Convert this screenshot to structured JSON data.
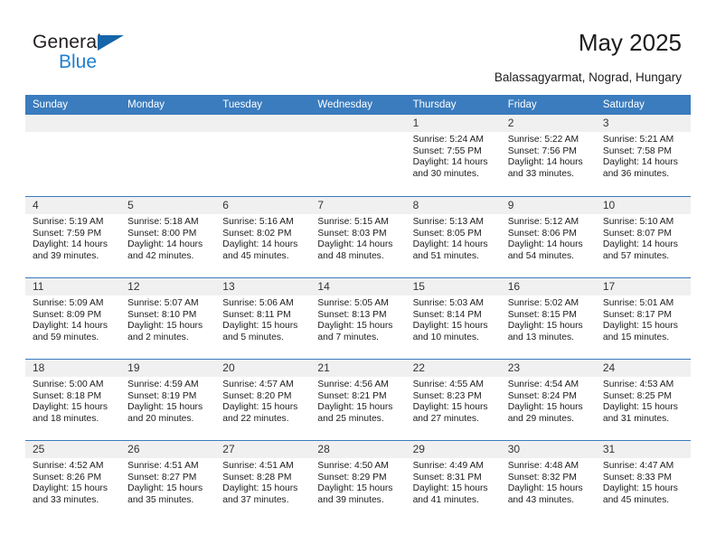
{
  "brand": {
    "name_part1": "General",
    "name_part2": "Blue",
    "triangle_icon": "triangle-icon",
    "color_dark": "#231f20",
    "color_blue": "#1f7fd0"
  },
  "header": {
    "title": "May 2025",
    "subtitle": "Balassagyarmat, Nograd, Hungary"
  },
  "theme": {
    "header_blue": "#3a7cbe",
    "band_gray": "#f0f0f0",
    "text": "#1c1c1c"
  },
  "calendar": {
    "weekday_headers": [
      "Sunday",
      "Monday",
      "Tuesday",
      "Wednesday",
      "Thursday",
      "Friday",
      "Saturday"
    ],
    "weeks": [
      [
        {
          "day": "",
          "empty": true
        },
        {
          "day": "",
          "empty": true
        },
        {
          "day": "",
          "empty": true
        },
        {
          "day": "",
          "empty": true
        },
        {
          "day": "1",
          "sunrise": "Sunrise: 5:24 AM",
          "sunset": "Sunset: 7:55 PM",
          "daylight1": "Daylight: 14 hours",
          "daylight2": "and 30 minutes."
        },
        {
          "day": "2",
          "sunrise": "Sunrise: 5:22 AM",
          "sunset": "Sunset: 7:56 PM",
          "daylight1": "Daylight: 14 hours",
          "daylight2": "and 33 minutes."
        },
        {
          "day": "3",
          "sunrise": "Sunrise: 5:21 AM",
          "sunset": "Sunset: 7:58 PM",
          "daylight1": "Daylight: 14 hours",
          "daylight2": "and 36 minutes."
        }
      ],
      [
        {
          "day": "4",
          "sunrise": "Sunrise: 5:19 AM",
          "sunset": "Sunset: 7:59 PM",
          "daylight1": "Daylight: 14 hours",
          "daylight2": "and 39 minutes."
        },
        {
          "day": "5",
          "sunrise": "Sunrise: 5:18 AM",
          "sunset": "Sunset: 8:00 PM",
          "daylight1": "Daylight: 14 hours",
          "daylight2": "and 42 minutes."
        },
        {
          "day": "6",
          "sunrise": "Sunrise: 5:16 AM",
          "sunset": "Sunset: 8:02 PM",
          "daylight1": "Daylight: 14 hours",
          "daylight2": "and 45 minutes."
        },
        {
          "day": "7",
          "sunrise": "Sunrise: 5:15 AM",
          "sunset": "Sunset: 8:03 PM",
          "daylight1": "Daylight: 14 hours",
          "daylight2": "and 48 minutes."
        },
        {
          "day": "8",
          "sunrise": "Sunrise: 5:13 AM",
          "sunset": "Sunset: 8:05 PM",
          "daylight1": "Daylight: 14 hours",
          "daylight2": "and 51 minutes."
        },
        {
          "day": "9",
          "sunrise": "Sunrise: 5:12 AM",
          "sunset": "Sunset: 8:06 PM",
          "daylight1": "Daylight: 14 hours",
          "daylight2": "and 54 minutes."
        },
        {
          "day": "10",
          "sunrise": "Sunrise: 5:10 AM",
          "sunset": "Sunset: 8:07 PM",
          "daylight1": "Daylight: 14 hours",
          "daylight2": "and 57 minutes."
        }
      ],
      [
        {
          "day": "11",
          "sunrise": "Sunrise: 5:09 AM",
          "sunset": "Sunset: 8:09 PM",
          "daylight1": "Daylight: 14 hours",
          "daylight2": "and 59 minutes."
        },
        {
          "day": "12",
          "sunrise": "Sunrise: 5:07 AM",
          "sunset": "Sunset: 8:10 PM",
          "daylight1": "Daylight: 15 hours",
          "daylight2": "and 2 minutes."
        },
        {
          "day": "13",
          "sunrise": "Sunrise: 5:06 AM",
          "sunset": "Sunset: 8:11 PM",
          "daylight1": "Daylight: 15 hours",
          "daylight2": "and 5 minutes."
        },
        {
          "day": "14",
          "sunrise": "Sunrise: 5:05 AM",
          "sunset": "Sunset: 8:13 PM",
          "daylight1": "Daylight: 15 hours",
          "daylight2": "and 7 minutes."
        },
        {
          "day": "15",
          "sunrise": "Sunrise: 5:03 AM",
          "sunset": "Sunset: 8:14 PM",
          "daylight1": "Daylight: 15 hours",
          "daylight2": "and 10 minutes."
        },
        {
          "day": "16",
          "sunrise": "Sunrise: 5:02 AM",
          "sunset": "Sunset: 8:15 PM",
          "daylight1": "Daylight: 15 hours",
          "daylight2": "and 13 minutes."
        },
        {
          "day": "17",
          "sunrise": "Sunrise: 5:01 AM",
          "sunset": "Sunset: 8:17 PM",
          "daylight1": "Daylight: 15 hours",
          "daylight2": "and 15 minutes."
        }
      ],
      [
        {
          "day": "18",
          "sunrise": "Sunrise: 5:00 AM",
          "sunset": "Sunset: 8:18 PM",
          "daylight1": "Daylight: 15 hours",
          "daylight2": "and 18 minutes."
        },
        {
          "day": "19",
          "sunrise": "Sunrise: 4:59 AM",
          "sunset": "Sunset: 8:19 PM",
          "daylight1": "Daylight: 15 hours",
          "daylight2": "and 20 minutes."
        },
        {
          "day": "20",
          "sunrise": "Sunrise: 4:57 AM",
          "sunset": "Sunset: 8:20 PM",
          "daylight1": "Daylight: 15 hours",
          "daylight2": "and 22 minutes."
        },
        {
          "day": "21",
          "sunrise": "Sunrise: 4:56 AM",
          "sunset": "Sunset: 8:21 PM",
          "daylight1": "Daylight: 15 hours",
          "daylight2": "and 25 minutes."
        },
        {
          "day": "22",
          "sunrise": "Sunrise: 4:55 AM",
          "sunset": "Sunset: 8:23 PM",
          "daylight1": "Daylight: 15 hours",
          "daylight2": "and 27 minutes."
        },
        {
          "day": "23",
          "sunrise": "Sunrise: 4:54 AM",
          "sunset": "Sunset: 8:24 PM",
          "daylight1": "Daylight: 15 hours",
          "daylight2": "and 29 minutes."
        },
        {
          "day": "24",
          "sunrise": "Sunrise: 4:53 AM",
          "sunset": "Sunset: 8:25 PM",
          "daylight1": "Daylight: 15 hours",
          "daylight2": "and 31 minutes."
        }
      ],
      [
        {
          "day": "25",
          "sunrise": "Sunrise: 4:52 AM",
          "sunset": "Sunset: 8:26 PM",
          "daylight1": "Daylight: 15 hours",
          "daylight2": "and 33 minutes."
        },
        {
          "day": "26",
          "sunrise": "Sunrise: 4:51 AM",
          "sunset": "Sunset: 8:27 PM",
          "daylight1": "Daylight: 15 hours",
          "daylight2": "and 35 minutes."
        },
        {
          "day": "27",
          "sunrise": "Sunrise: 4:51 AM",
          "sunset": "Sunset: 8:28 PM",
          "daylight1": "Daylight: 15 hours",
          "daylight2": "and 37 minutes."
        },
        {
          "day": "28",
          "sunrise": "Sunrise: 4:50 AM",
          "sunset": "Sunset: 8:29 PM",
          "daylight1": "Daylight: 15 hours",
          "daylight2": "and 39 minutes."
        },
        {
          "day": "29",
          "sunrise": "Sunrise: 4:49 AM",
          "sunset": "Sunset: 8:31 PM",
          "daylight1": "Daylight: 15 hours",
          "daylight2": "and 41 minutes."
        },
        {
          "day": "30",
          "sunrise": "Sunrise: 4:48 AM",
          "sunset": "Sunset: 8:32 PM",
          "daylight1": "Daylight: 15 hours",
          "daylight2": "and 43 minutes."
        },
        {
          "day": "31",
          "sunrise": "Sunrise: 4:47 AM",
          "sunset": "Sunset: 8:33 PM",
          "daylight1": "Daylight: 15 hours",
          "daylight2": "and 45 minutes."
        }
      ]
    ]
  }
}
